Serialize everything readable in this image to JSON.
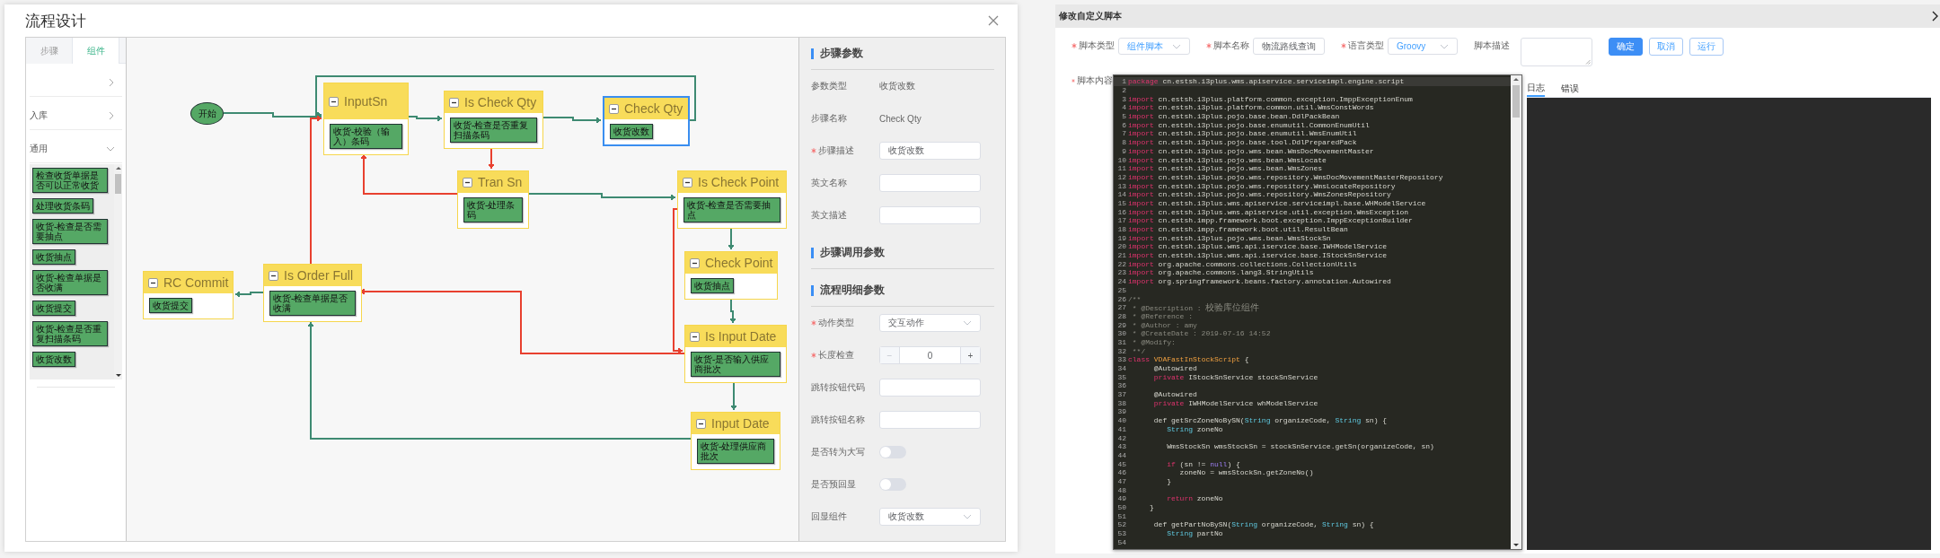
{
  "flow_dialog": {
    "title": "流程设计",
    "sidebar": {
      "tabs": [
        {
          "label": "步骤",
          "selected": false
        },
        {
          "label": "组件",
          "selected": true
        }
      ],
      "groups": [
        {
          "expanded": false
        },
        {
          "label": "入库",
          "expanded": false
        },
        {
          "label": "通用",
          "expanded": true,
          "components": [
            "检查收货单据是否可以正常收货",
            "处理收货条码",
            "收货-检查是否需要抽点",
            "收货抽点",
            "收货-检查单据是否收满",
            "收货提交",
            "收货-检查是否重复扫描条码",
            "收货改数"
          ]
        }
      ]
    },
    "canvas": {
      "nodes": [
        {
          "kind": "start",
          "label": "开始"
        },
        {
          "kind": "step",
          "title": "InputSn",
          "component": "收货-校验（输入）条码",
          "selected": false
        },
        {
          "kind": "step",
          "title": "Is Check Qty",
          "component": "收货-检查是否重复扫描条码",
          "selected": false
        },
        {
          "kind": "step",
          "title": "Check Qty",
          "component": "收货改数",
          "selected": true
        },
        {
          "kind": "step",
          "title": "Tran Sn",
          "component": "收货-处理条码",
          "selected": false
        },
        {
          "kind": "step",
          "title": "Is Check Point",
          "component": "收货-检查是否需要抽点",
          "selected": false
        },
        {
          "kind": "step",
          "title": "Check Point",
          "component": "收货抽点",
          "selected": false
        },
        {
          "kind": "step",
          "title": "Is Input Date",
          "component": "收货-是否输入供应商批次",
          "selected": false
        },
        {
          "kind": "step",
          "title": "Input Date",
          "component": "收货-处理供应商批次",
          "selected": false
        },
        {
          "kind": "step",
          "title": "RC Commit",
          "component": "收货提交",
          "selected": false
        },
        {
          "kind": "step",
          "title": "Is Order Full",
          "component": "收货-检查单据是否收满",
          "selected": false
        }
      ],
      "edges": [
        {
          "color": "#3e8a72"
        },
        {
          "color": "#3e8a72"
        },
        {
          "color": "#3e8a72"
        },
        {
          "color": "#3e8a72"
        },
        {
          "color": "#e8402f"
        },
        {
          "color": "#e8402f"
        },
        {
          "color": "#3e8a72"
        },
        {
          "color": "#3e8a72"
        },
        {
          "color": "#3e8a72"
        },
        {
          "color": "#e8402f"
        },
        {
          "color": "#e8402f"
        },
        {
          "color": "#3e8a72"
        },
        {
          "color": "#3e8a72"
        },
        {
          "color": "#3e8a72"
        },
        {
          "color": "#e8402f"
        }
      ]
    },
    "params": {
      "sections": [
        {
          "title": "步骤参数",
          "rows": [
            {
              "kind": "text",
              "label": "参数类型",
              "required": false,
              "value": "收货改数"
            },
            {
              "kind": "text",
              "label": "步骤名称",
              "required": false,
              "value": "Check Qty"
            },
            {
              "kind": "input",
              "label": "步骤描述",
              "required": true,
              "value": "收货改数"
            },
            {
              "kind": "input",
              "label": "英文名称",
              "required": false
            },
            {
              "kind": "input",
              "label": "英文描述",
              "required": false
            }
          ]
        },
        {
          "title": "步骤调用参数"
        },
        {
          "title": "流程明细参数",
          "rows": [
            {
              "kind": "select",
              "label": "动作类型",
              "required": true,
              "value": "交互动作"
            },
            {
              "kind": "stepper",
              "label": "长度检查",
              "required": true,
              "value": "0",
              "minus": "−",
              "plus": "+"
            },
            {
              "kind": "input",
              "label": "跳转按钮代码",
              "required": false
            },
            {
              "kind": "input",
              "label": "跳转按钮名称",
              "required": false
            },
            {
              "kind": "switch",
              "label": "是否转为大写",
              "required": false,
              "on": false
            },
            {
              "kind": "switch",
              "label": "是否预回显",
              "required": false,
              "on": false
            },
            {
              "kind": "select",
              "label": "回显组件",
              "required": false,
              "value": "收货改数"
            }
          ]
        }
      ]
    }
  },
  "script_panel": {
    "title": "修改自定义脚本",
    "fields": [
      {
        "kind": "select",
        "label": "脚本类型",
        "required": true,
        "value": "组件脚本"
      },
      {
        "kind": "input",
        "label": "脚本名称",
        "required": true,
        "value": "物流路线查询"
      },
      {
        "kind": "select",
        "label": "语言类型",
        "required": true,
        "value": "Groovy"
      },
      {
        "kind": "textarea",
        "label": "脚本描述",
        "required": false
      }
    ],
    "buttons": [
      {
        "label": "确定",
        "primary": true
      },
      {
        "label": "取消",
        "primary": false
      },
      {
        "label": "运行",
        "primary": false
      }
    ],
    "content_label": "脚本内容",
    "content_required": true,
    "code": [
      {
        "n": "1",
        "active": true,
        "tokens": [
          {
            "kind": "keyword",
            "text": "package"
          },
          {
            "kind": "plain",
            "text": " cn.estsh.i3plus.wms.apiservice.serviceimpl.engine.script"
          }
        ]
      },
      {
        "n": "2",
        "active": false
      },
      {
        "n": "3",
        "active": false,
        "tokens": [
          {
            "kind": "keyword",
            "text": "import"
          },
          {
            "kind": "plain",
            "text": " cn.estsh.i3plus.platform.common.exception.ImppExceptionEnum"
          }
        ]
      },
      {
        "n": "4",
        "active": false,
        "tokens": [
          {
            "kind": "keyword",
            "text": "import"
          },
          {
            "kind": "plain",
            "text": " cn.estsh.i3plus.platform.common.util.WmsConstWords"
          }
        ]
      },
      {
        "n": "5",
        "active": false,
        "tokens": [
          {
            "kind": "keyword",
            "text": "import"
          },
          {
            "kind": "plain",
            "text": " cn.estsh.i3plus.pojo.base.bean.DdlPackBean"
          }
        ]
      },
      {
        "n": "6",
        "active": false,
        "tokens": [
          {
            "kind": "keyword",
            "text": "import"
          },
          {
            "kind": "plain",
            "text": " cn.estsh.i3plus.pojo.base.enumutil.CommonEnumUtil"
          }
        ]
      },
      {
        "n": "7",
        "active": false,
        "tokens": [
          {
            "kind": "keyword",
            "text": "import"
          },
          {
            "kind": "plain",
            "text": " cn.estsh.i3plus.pojo.base.enumutil.WmsEnumUtil"
          }
        ]
      },
      {
        "n": "8",
        "active": false,
        "tokens": [
          {
            "kind": "keyword",
            "text": "import"
          },
          {
            "kind": "plain",
            "text": " cn.estsh.i3plus.pojo.base.tool.DdlPreparedPack"
          }
        ]
      },
      {
        "n": "9",
        "active": false,
        "tokens": [
          {
            "kind": "keyword",
            "text": "import"
          },
          {
            "kind": "plain",
            "text": " cn.estsh.i3plus.pojo.wms.bean.WmsDocMovementMaster"
          }
        ]
      },
      {
        "n": "10",
        "active": false,
        "tokens": [
          {
            "kind": "keyword",
            "text": "import"
          },
          {
            "kind": "plain",
            "text": " cn.estsh.i3plus.pojo.wms.bean.WmsLocate"
          }
        ]
      },
      {
        "n": "11",
        "active": false,
        "tokens": [
          {
            "kind": "keyword",
            "text": "import"
          },
          {
            "kind": "plain",
            "text": " cn.estsh.i3plus.pojo.wms.bean.WmsZones"
          }
        ]
      },
      {
        "n": "12",
        "active": false,
        "tokens": [
          {
            "kind": "keyword",
            "text": "import"
          },
          {
            "kind": "plain",
            "text": " cn.estsh.i3plus.pojo.wms.repository.WmsDocMovementMasterRepository"
          }
        ]
      },
      {
        "n": "13",
        "active": false,
        "tokens": [
          {
            "kind": "keyword",
            "text": "import"
          },
          {
            "kind": "plain",
            "text": " cn.estsh.i3plus.pojo.wms.repository.WmsLocateRepository"
          }
        ]
      },
      {
        "n": "14",
        "active": false,
        "tokens": [
          {
            "kind": "keyword",
            "text": "import"
          },
          {
            "kind": "plain",
            "text": " cn.estsh.i3plus.pojo.wms.repository.WmsZonesRepository"
          }
        ]
      },
      {
        "n": "15",
        "active": false,
        "tokens": [
          {
            "kind": "keyword",
            "text": "import"
          },
          {
            "kind": "plain",
            "text": " cn.estsh.i3plus.wms.apiservice.serviceimpl.base.WHModelService"
          }
        ]
      },
      {
        "n": "16",
        "active": false,
        "tokens": [
          {
            "kind": "keyword",
            "text": "import"
          },
          {
            "kind": "plain",
            "text": " cn.estsh.i3plus.wms.apiservice.util.exception.WmsException"
          }
        ]
      },
      {
        "n": "17",
        "active": false,
        "tokens": [
          {
            "kind": "keyword",
            "text": "import"
          },
          {
            "kind": "plain",
            "text": " cn.estsh.impp.framework.boot.exception.ImppExceptionBuilder"
          }
        ]
      },
      {
        "n": "18",
        "active": false,
        "tokens": [
          {
            "kind": "keyword",
            "text": "import"
          },
          {
            "kind": "plain",
            "text": " cn.estsh.impp.framework.boot.util.ResultBean"
          }
        ]
      },
      {
        "n": "19",
        "active": false,
        "tokens": [
          {
            "kind": "keyword",
            "text": "import"
          },
          {
            "kind": "plain",
            "text": " cn.estsh.i3plus.pojo.wms.bean.WmsStockSn"
          }
        ]
      },
      {
        "n": "20",
        "active": false,
        "tokens": [
          {
            "kind": "keyword",
            "text": "import"
          },
          {
            "kind": "plain",
            "text": " cn.estsh.i3plus.wms.api.iservice.base.IWHModelService"
          }
        ]
      },
      {
        "n": "21",
        "active": false,
        "tokens": [
          {
            "kind": "keyword",
            "text": "import"
          },
          {
            "kind": "plain",
            "text": " cn.estsh.i3plus.wms.api.iservice.base.IStockSnService"
          }
        ]
      },
      {
        "n": "22",
        "active": false,
        "tokens": [
          {
            "kind": "keyword",
            "text": "import"
          },
          {
            "kind": "plain",
            "text": " org.apache.commons.collections.CollectionUtils"
          }
        ]
      },
      {
        "n": "23",
        "active": false,
        "tokens": [
          {
            "kind": "keyword",
            "text": "import"
          },
          {
            "kind": "plain",
            "text": " org.apache.commons.lang3.StringUtils"
          }
        ]
      },
      {
        "n": "24",
        "active": false,
        "tokens": [
          {
            "kind": "keyword",
            "text": "import"
          },
          {
            "kind": "plain",
            "text": " org.springframework.beans.factory.annotation.Autowired"
          }
        ]
      },
      {
        "n": "25",
        "active": false
      },
      {
        "n": "26",
        "active": false,
        "tokens": [
          {
            "kind": "comment",
            "text": "/**"
          }
        ]
      },
      {
        "n": "27",
        "active": false,
        "tokens": [
          {
            "kind": "comment",
            "text": " * @Description : "
          },
          {
            "kind": "comment_wide",
            "text": "校验库位组件"
          }
        ]
      },
      {
        "n": "28",
        "active": false,
        "tokens": [
          {
            "kind": "comment",
            "text": " * @Reference :"
          }
        ]
      },
      {
        "n": "29",
        "active": false,
        "tokens": [
          {
            "kind": "comment",
            "text": " * @Author : amy"
          }
        ]
      },
      {
        "n": "30",
        "active": false,
        "tokens": [
          {
            "kind": "comment",
            "text": " * @CreateDate : 2019-07-16 14:52"
          }
        ]
      },
      {
        "n": "31",
        "active": false,
        "tokens": [
          {
            "kind": "comment",
            "text": " * @Modify:"
          }
        ]
      },
      {
        "n": "32",
        "active": false,
        "tokens": [
          {
            "kind": "comment",
            "text": " **/"
          }
        ]
      },
      {
        "n": "33",
        "active": false,
        "tokens": [
          {
            "kind": "keyword",
            "text": "class"
          },
          {
            "kind": "class",
            "text": " VDAFastInStockScript"
          },
          {
            "kind": "plain",
            "text": " {"
          }
        ]
      },
      {
        "n": "34",
        "active": false,
        "tokens": [
          {
            "kind": "plain",
            "text": "      @Autowired"
          }
        ]
      },
      {
        "n": "35",
        "active": false,
        "tokens": [
          {
            "kind": "keyword",
            "text": "      private"
          },
          {
            "kind": "plain",
            "text": " IStockSnService stockSnService"
          }
        ]
      },
      {
        "n": "36",
        "active": false
      },
      {
        "n": "37",
        "active": false,
        "tokens": [
          {
            "kind": "plain",
            "text": "      @Autowired"
          }
        ]
      },
      {
        "n": "38",
        "active": false,
        "tokens": [
          {
            "kind": "keyword",
            "text": "      private"
          },
          {
            "kind": "plain",
            "text": " IWHModelService whModelService"
          }
        ]
      },
      {
        "n": "39",
        "active": false
      },
      {
        "n": "40",
        "active": false,
        "tokens": [
          {
            "kind": "plain",
            "text": "      def getSrcZoneNoBySN("
          },
          {
            "kind": "type",
            "text": "String"
          },
          {
            "kind": "plain",
            "text": " organizeCode, "
          },
          {
            "kind": "type",
            "text": "String"
          },
          {
            "kind": "plain",
            "text": " sn) {"
          }
        ]
      },
      {
        "n": "41",
        "active": false,
        "tokens": [
          {
            "kind": "type",
            "text": "         String"
          },
          {
            "kind": "plain",
            "text": " zoneNo"
          }
        ]
      },
      {
        "n": "42",
        "active": false
      },
      {
        "n": "43",
        "active": false,
        "tokens": [
          {
            "kind": "plain",
            "text": "         WmsStockSn wmsStockSn = stockSnService.getSn(organizeCode, sn)"
          }
        ]
      },
      {
        "n": "44",
        "active": false
      },
      {
        "n": "45",
        "active": false,
        "tokens": [
          {
            "kind": "keyword",
            "text": "         if"
          },
          {
            "kind": "plain",
            "text": " (sn != "
          },
          {
            "kind": "null",
            "text": "null"
          },
          {
            "kind": "plain",
            "text": ") {"
          }
        ]
      },
      {
        "n": "46",
        "active": false,
        "tokens": [
          {
            "kind": "plain",
            "text": "            zoneNo = wmsStockSn.getZoneNo()"
          }
        ]
      },
      {
        "n": "47",
        "active": false,
        "tokens": [
          {
            "kind": "plain",
            "text": "         }"
          }
        ]
      },
      {
        "n": "48",
        "active": false
      },
      {
        "n": "49",
        "active": false,
        "tokens": [
          {
            "kind": "keyword",
            "text": "         return"
          },
          {
            "kind": "plain",
            "text": " zoneNo"
          }
        ]
      },
      {
        "n": "50",
        "active": false,
        "tokens": [
          {
            "kind": "plain",
            "text": "     }"
          }
        ]
      },
      {
        "n": "51",
        "active": false
      },
      {
        "n": "52",
        "active": false,
        "tokens": [
          {
            "kind": "plain",
            "text": "      def getPartNoBySN("
          },
          {
            "kind": "type",
            "text": "String"
          },
          {
            "kind": "plain",
            "text": " organizeCode, "
          },
          {
            "kind": "type",
            "text": "String"
          },
          {
            "kind": "plain",
            "text": " sn) {"
          }
        ]
      },
      {
        "n": "53",
        "active": false,
        "tokens": [
          {
            "kind": "type",
            "text": "         String"
          },
          {
            "kind": "plain",
            "text": " partNo"
          }
        ]
      },
      {
        "n": "54",
        "active": false
      }
    ],
    "log_tabs": [
      {
        "label": "日志",
        "selected": true
      },
      {
        "label": "错误",
        "selected": false
      }
    ]
  }
}
